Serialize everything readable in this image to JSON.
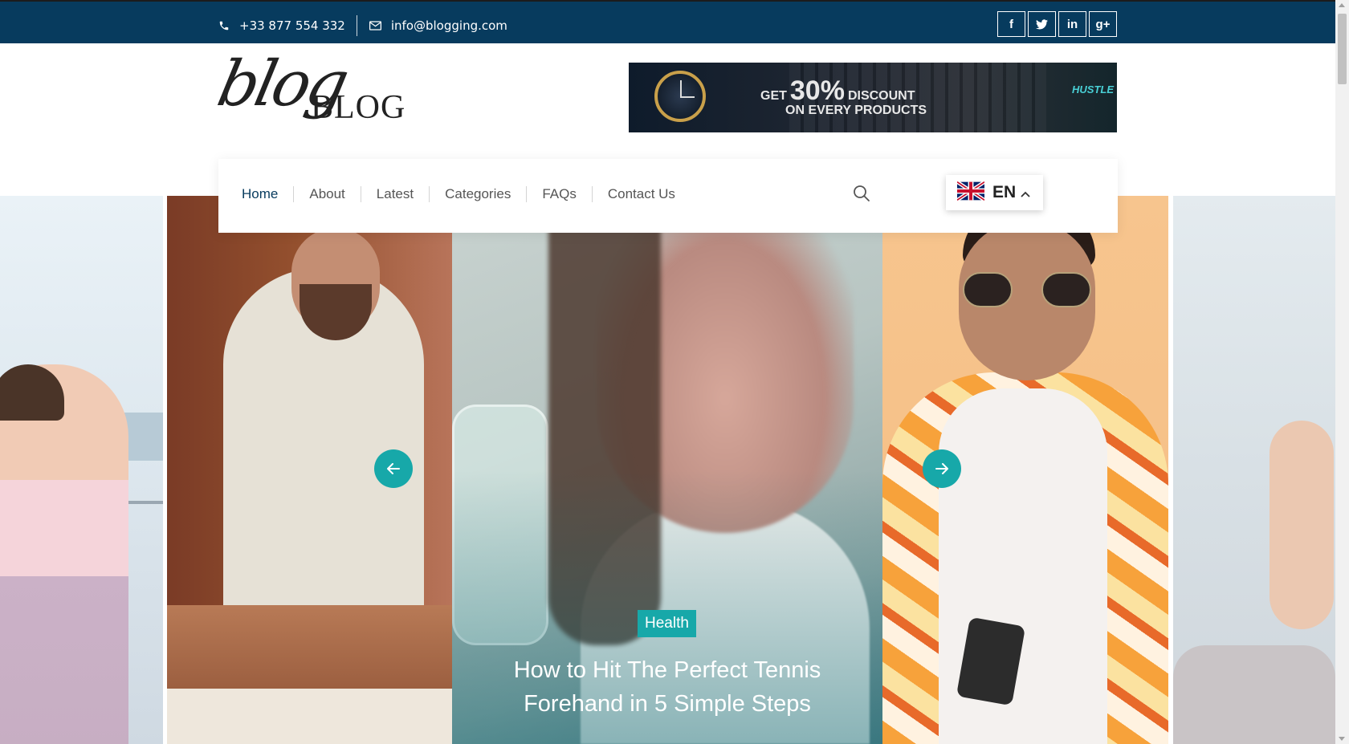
{
  "topbar": {
    "phone": "+33 877 554 332",
    "email": "info@blogging.com",
    "phone_icon": "phone-icon",
    "email_icon": "envelope-icon",
    "background": "#073b5e",
    "social": [
      {
        "icon": "facebook-icon",
        "glyph": "f"
      },
      {
        "icon": "twitter-icon",
        "glyph": "t"
      },
      {
        "icon": "linkedin-icon",
        "glyph": "in"
      },
      {
        "icon": "google-plus-icon",
        "glyph": "g+"
      }
    ]
  },
  "logo": {
    "script": "blog",
    "word": "BLOG"
  },
  "ad_banner": {
    "get": "GET",
    "percent": "30%",
    "discount": "DISCOUNT",
    "line2": "ON EVERY PRODUCTS",
    "brand": "HUSTLE"
  },
  "nav": {
    "items": [
      {
        "label": "Home",
        "active": true
      },
      {
        "label": "About",
        "active": false
      },
      {
        "label": "Latest",
        "active": false
      },
      {
        "label": "Categories",
        "active": false
      },
      {
        "label": "FAQs",
        "active": false
      },
      {
        "label": "Contact Us",
        "active": false
      }
    ],
    "search_icon": "search-icon",
    "language": {
      "code": "EN",
      "flag": "uk-flag-icon"
    }
  },
  "slider": {
    "active_slide": {
      "category": "Health",
      "title": "How to Hit The Perfect Tennis Forehand in 5 Simple Steps"
    },
    "prev_icon": "arrow-left-icon",
    "next_icon": "arrow-right-icon",
    "accent": "#17a8a9"
  }
}
